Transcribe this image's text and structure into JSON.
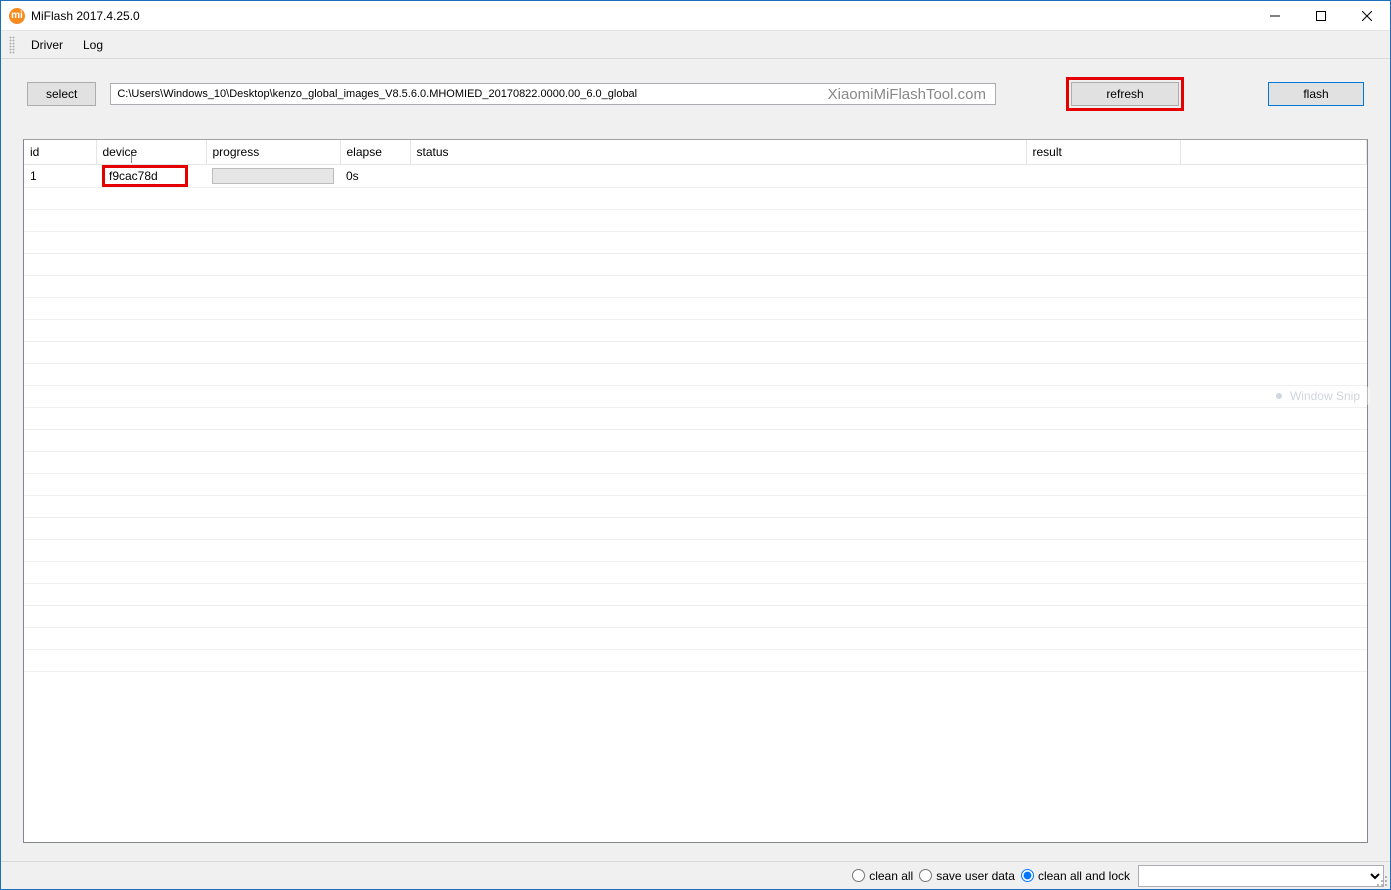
{
  "window": {
    "title": "MiFlash 2017.4.25.0",
    "app_icon_glyph": "mi"
  },
  "menu": {
    "driver": "Driver",
    "log": "Log"
  },
  "toolbar": {
    "select_label": "select",
    "path_value": "C:\\Users\\Windows_10\\Desktop\\kenzo_global_images_V8.5.6.0.MHOMIED_20170822.0000.00_6.0_global",
    "watermark": "XiaomiMiFlashTool.com",
    "refresh_label": "refresh",
    "flash_label": "flash"
  },
  "grid": {
    "headers": {
      "id": "id",
      "device": "device",
      "progress": "progress",
      "elapse": "elapse",
      "status": "status",
      "result": "result"
    },
    "rows": [
      {
        "id": "1",
        "device": "f9cac78d",
        "elapse": "0s",
        "status": "",
        "result": ""
      }
    ]
  },
  "footer": {
    "options": {
      "clean_all": "clean all",
      "save_user_data": "save user data",
      "clean_all_and_lock": "clean all and lock"
    },
    "selected": "clean_all_and_lock"
  },
  "overlay": {
    "window_snip": "Window Snip"
  }
}
